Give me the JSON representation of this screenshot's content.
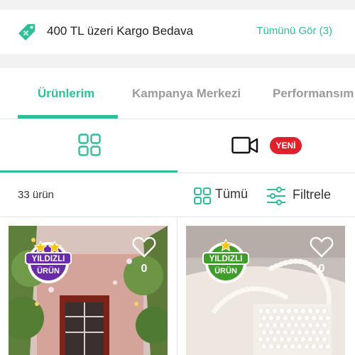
{
  "promo": {
    "text": "400 TL üzeri Kargo Bedava",
    "link": "Tümünü Gör (3)",
    "icon": "price-tag-icon"
  },
  "tabs": [
    {
      "label": "Ürünlerim",
      "active": true
    },
    {
      "label": "Kampanya Merkezi",
      "active": false
    },
    {
      "label": "Performansım",
      "active": false
    }
  ],
  "views": {
    "grid_icon": "grid-icon",
    "video_icon": "video-camera-icon",
    "new_badge": "YENİ"
  },
  "filters": {
    "count": "33 ürün",
    "all_label": "Tümü",
    "filter_label": "Filtrele"
  },
  "products": [
    {
      "badge_line1": "YILDIZLI",
      "badge_line2": "ÜRÜN",
      "likes": "0",
      "badge_color": "#6a2ba8"
    },
    {
      "badge_line1": "YILDIZLI",
      "badge_line2": "ÜRÜN",
      "likes": "0",
      "badge_color": "#3f9d2a"
    }
  ],
  "colors": {
    "accent": "#2fbf98",
    "new_badge": "#e0202a"
  }
}
